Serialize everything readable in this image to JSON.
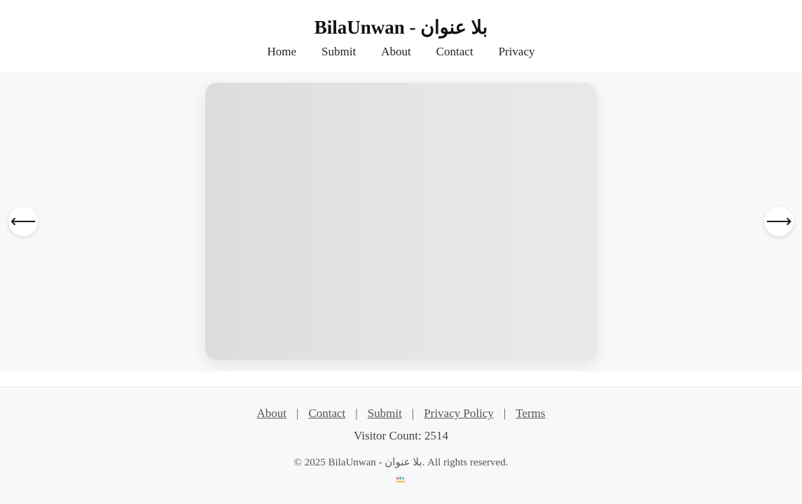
{
  "header": {
    "title": "BilaUnwan - بلا عنوان",
    "nav": [
      "Home",
      "Submit",
      "About",
      "Contact",
      "Privacy"
    ]
  },
  "carousel": {
    "prev_icon": "arrow-left",
    "next_icon": "arrow-right",
    "prev_glyph": "⟵",
    "next_glyph": "⟶"
  },
  "footer": {
    "links": [
      "About",
      "Contact",
      "Submit",
      "Privacy Policy",
      "Terms"
    ],
    "separator": "|",
    "visitor_count": "Visitor Count: 2514",
    "copyright": "© 2025 BilaUnwan - بلا عنوان. All rights reserved.",
    "badge_icon": "counter-badge-icon"
  },
  "colors": {
    "background": "#ffffff",
    "section_bg": "#f7f8f9",
    "card": "#e0e0e0",
    "text": "#222222",
    "muted": "#555555"
  }
}
